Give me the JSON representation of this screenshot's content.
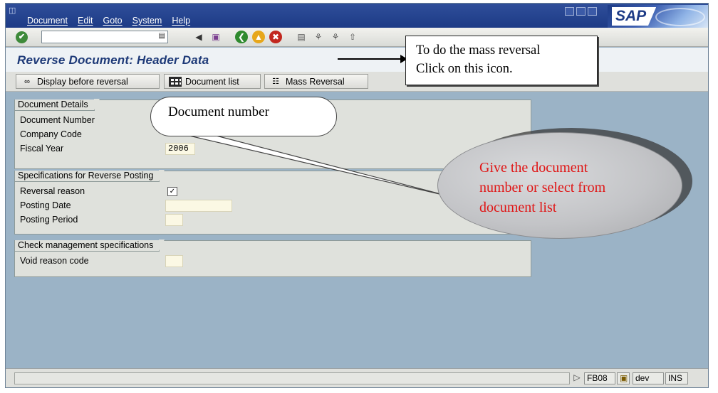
{
  "menu": {
    "items": [
      "Document",
      "Edit",
      "Goto",
      "System",
      "Help"
    ]
  },
  "toolbar": {
    "command_value": ""
  },
  "screen": {
    "title": "Reverse Document: Header Data"
  },
  "app_toolbar": {
    "display_before_reversal": "Display before reversal",
    "document_list": "Document list",
    "mass_reversal": "Mass Reversal"
  },
  "groups": {
    "document_details": {
      "title": "Document Details",
      "document_number_label": "Document Number",
      "company_code_label": "Company Code",
      "fiscal_year_label": "Fiscal Year",
      "fiscal_year_value": "2006"
    },
    "reverse_posting": {
      "title": "Specifications for Reverse Posting",
      "reversal_reason_label": "Reversal reason",
      "posting_date_label": "Posting Date",
      "posting_period_label": "Posting Period"
    },
    "check_management": {
      "title": "Check management specifications",
      "void_reason_label": "Void reason code"
    }
  },
  "status_bar": {
    "transaction": "FB08",
    "system": "dev",
    "mode": "INS"
  },
  "callouts": {
    "mass_reversal_line1": "To do the mass reversal",
    "mass_reversal_line2": "Click on this icon.",
    "document_number": "Document number",
    "give_line1": "Give the document",
    "give_line2": "number or select from",
    "give_line3": "document list",
    "give_color": "#e01515"
  },
  "logo": {
    "text": "SAP"
  }
}
